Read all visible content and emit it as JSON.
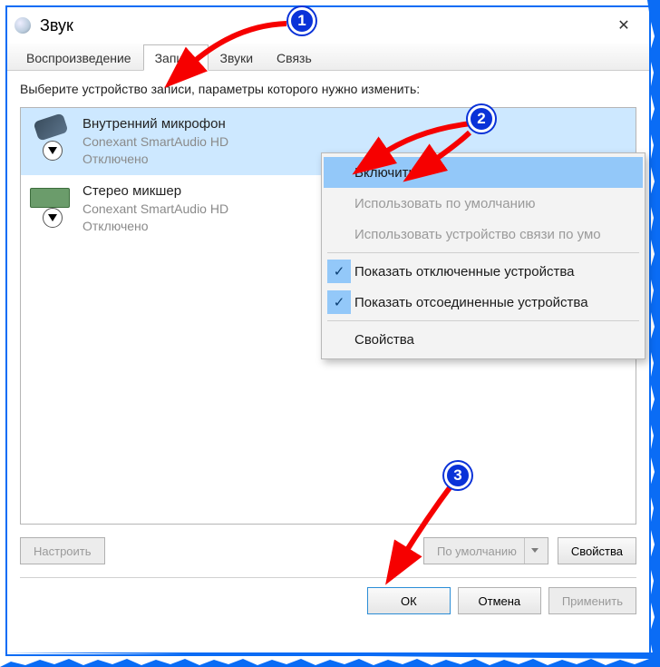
{
  "window": {
    "title": "Звук",
    "close_icon": "✕"
  },
  "tabs": [
    {
      "label": "Воспроизведение",
      "active": false
    },
    {
      "label": "Запись",
      "active": true
    },
    {
      "label": "Звуки",
      "active": false
    },
    {
      "label": "Связь",
      "active": false
    }
  ],
  "instruction": "Выберите устройство записи, параметры которого нужно изменить:",
  "devices": [
    {
      "name": "Внутренний микрофон",
      "driver": "Conexant SmartAudio HD",
      "status": "Отключено",
      "icon": "mic-icon",
      "selected": true
    },
    {
      "name": "Стерео микшер",
      "driver": "Conexant SmartAudio HD",
      "status": "Отключено",
      "icon": "mixer-icon",
      "selected": false
    }
  ],
  "context_menu": {
    "items": [
      {
        "label": "Включить",
        "highlight": true
      },
      {
        "label": "Использовать по умолчанию",
        "disabled": true
      },
      {
        "label": "Использовать устройство связи по умо",
        "disabled": true
      },
      {
        "separator": true
      },
      {
        "label": "Показать отключенные устройства",
        "checked": true
      },
      {
        "label": "Показать отсоединенные устройства",
        "checked": true
      },
      {
        "separator": true
      },
      {
        "label": "Свойства"
      }
    ]
  },
  "lower_buttons": {
    "configure": "Настроить",
    "set_default": "По умолчанию",
    "properties": "Свойства"
  },
  "footer": {
    "ok": "ОК",
    "cancel": "Отмена",
    "apply": "Применить"
  },
  "callouts": {
    "n1": "1",
    "n2": "2",
    "n3": "3"
  },
  "colors": {
    "accent": "#0a32d8",
    "highlight": "#93c8f9",
    "selection": "#cde8ff"
  }
}
